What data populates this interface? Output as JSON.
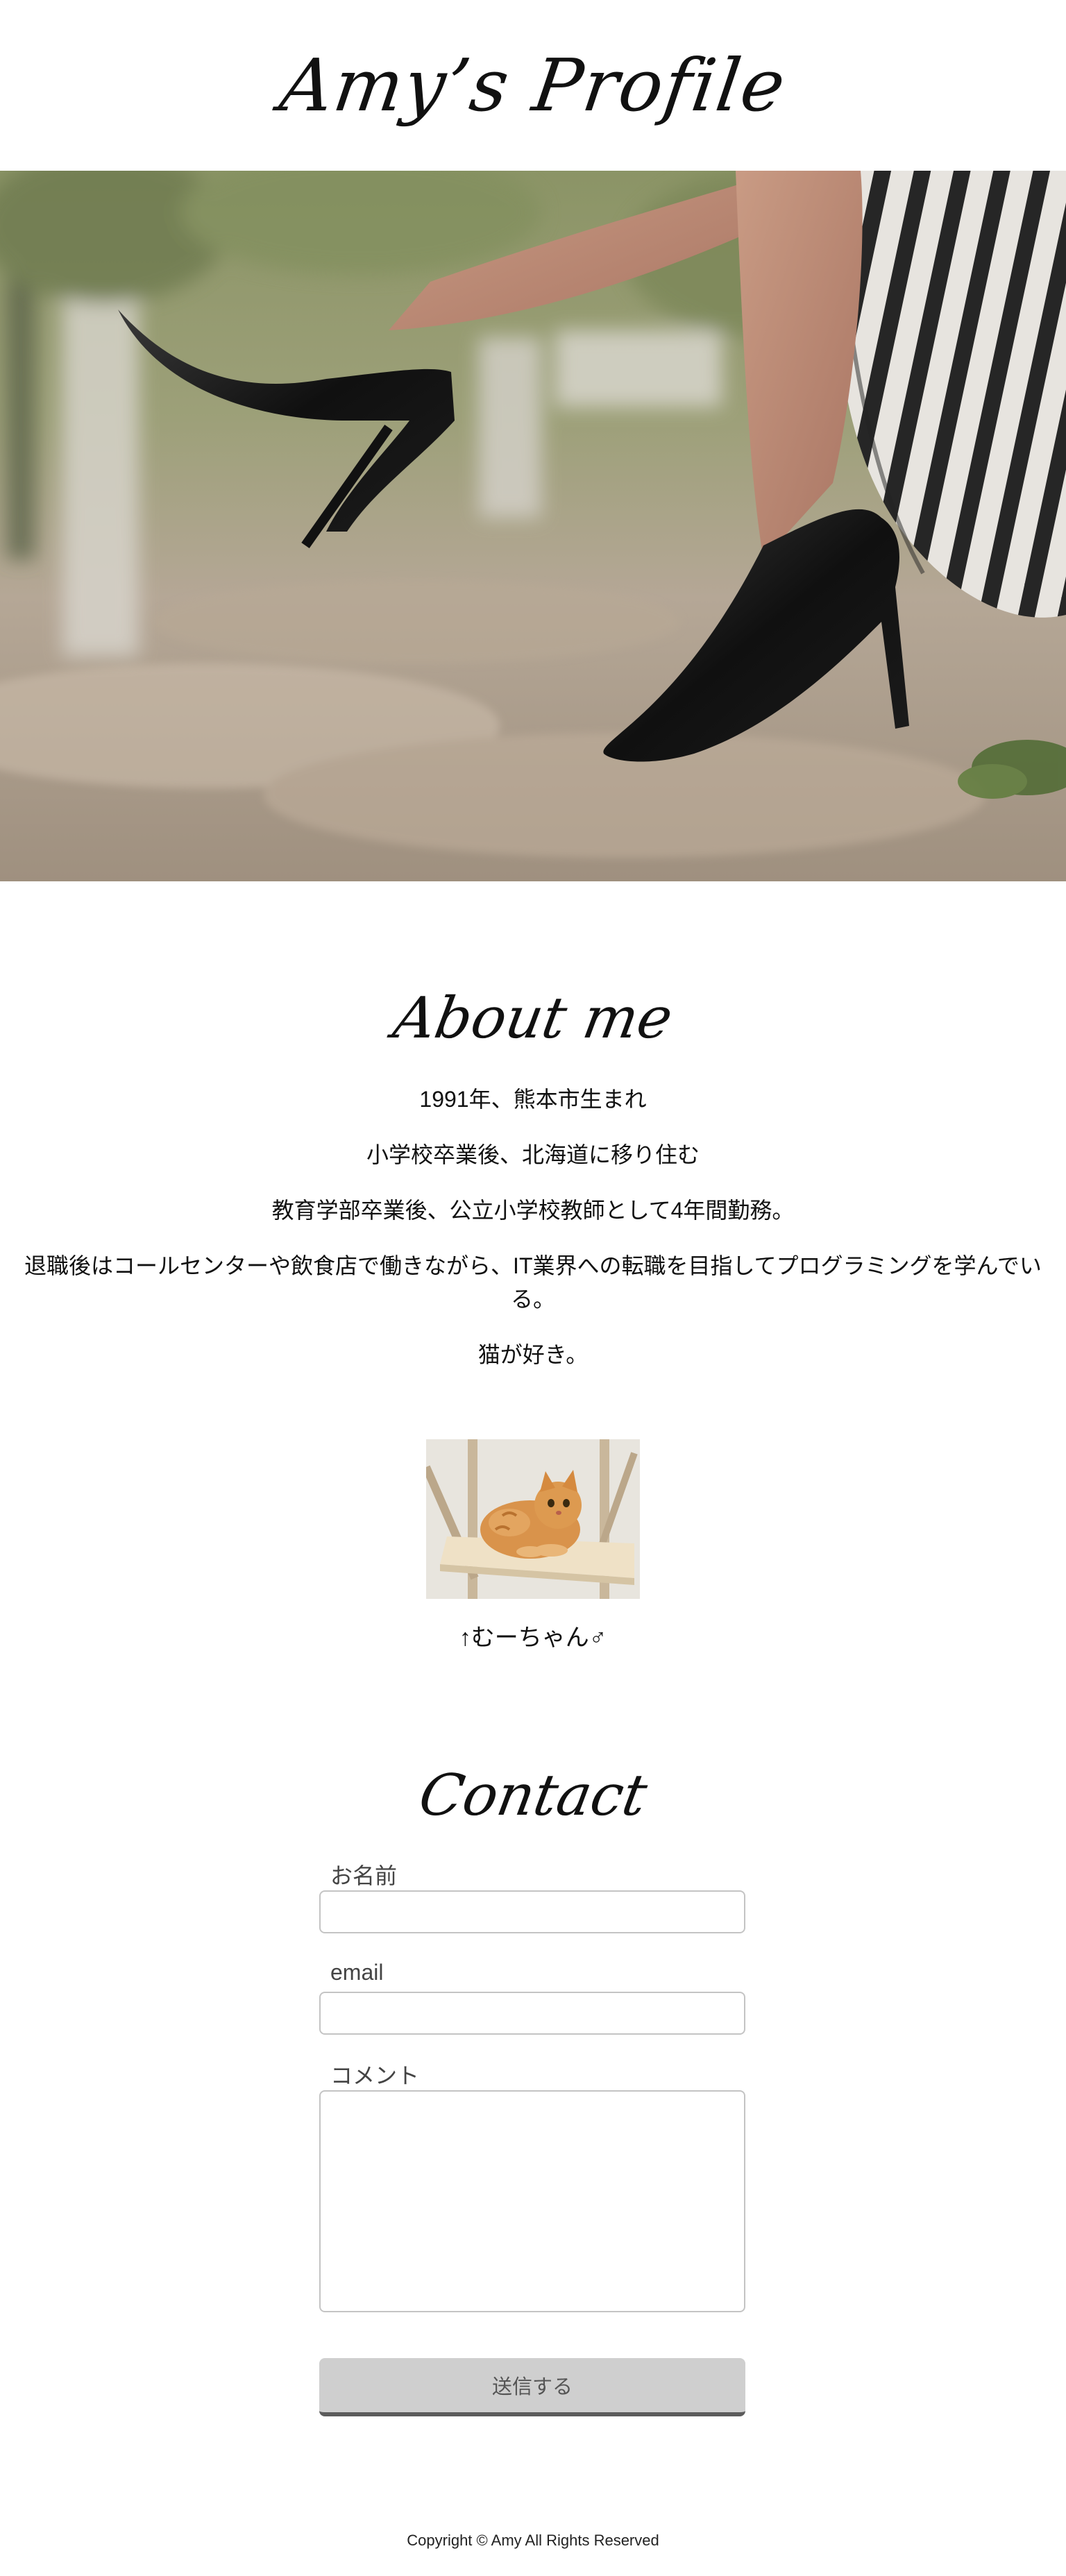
{
  "header": {
    "title": "Amy’s Profile"
  },
  "about": {
    "heading": "About me",
    "lines": [
      "1991年、熊本市生まれ",
      "小学校卒業後、北海道に移り住む",
      "教育学部卒業後、公立小学校教師として4年間勤務。",
      "退職後はコールセンターや飲食店で働きながら、IT業界への転職を目指してプログラミングを学んでいる。",
      "猫が好き。"
    ],
    "cat_caption": "↑むーちゃん♂"
  },
  "contact": {
    "heading": "Contact",
    "name_label": "お名前",
    "email_label": "email",
    "comment_label": "コメント",
    "name_value": "",
    "email_value": "",
    "comment_value": "",
    "submit_label": "送信する"
  },
  "footer": {
    "copyright": "Copyright © Amy All Rights Reserved"
  }
}
